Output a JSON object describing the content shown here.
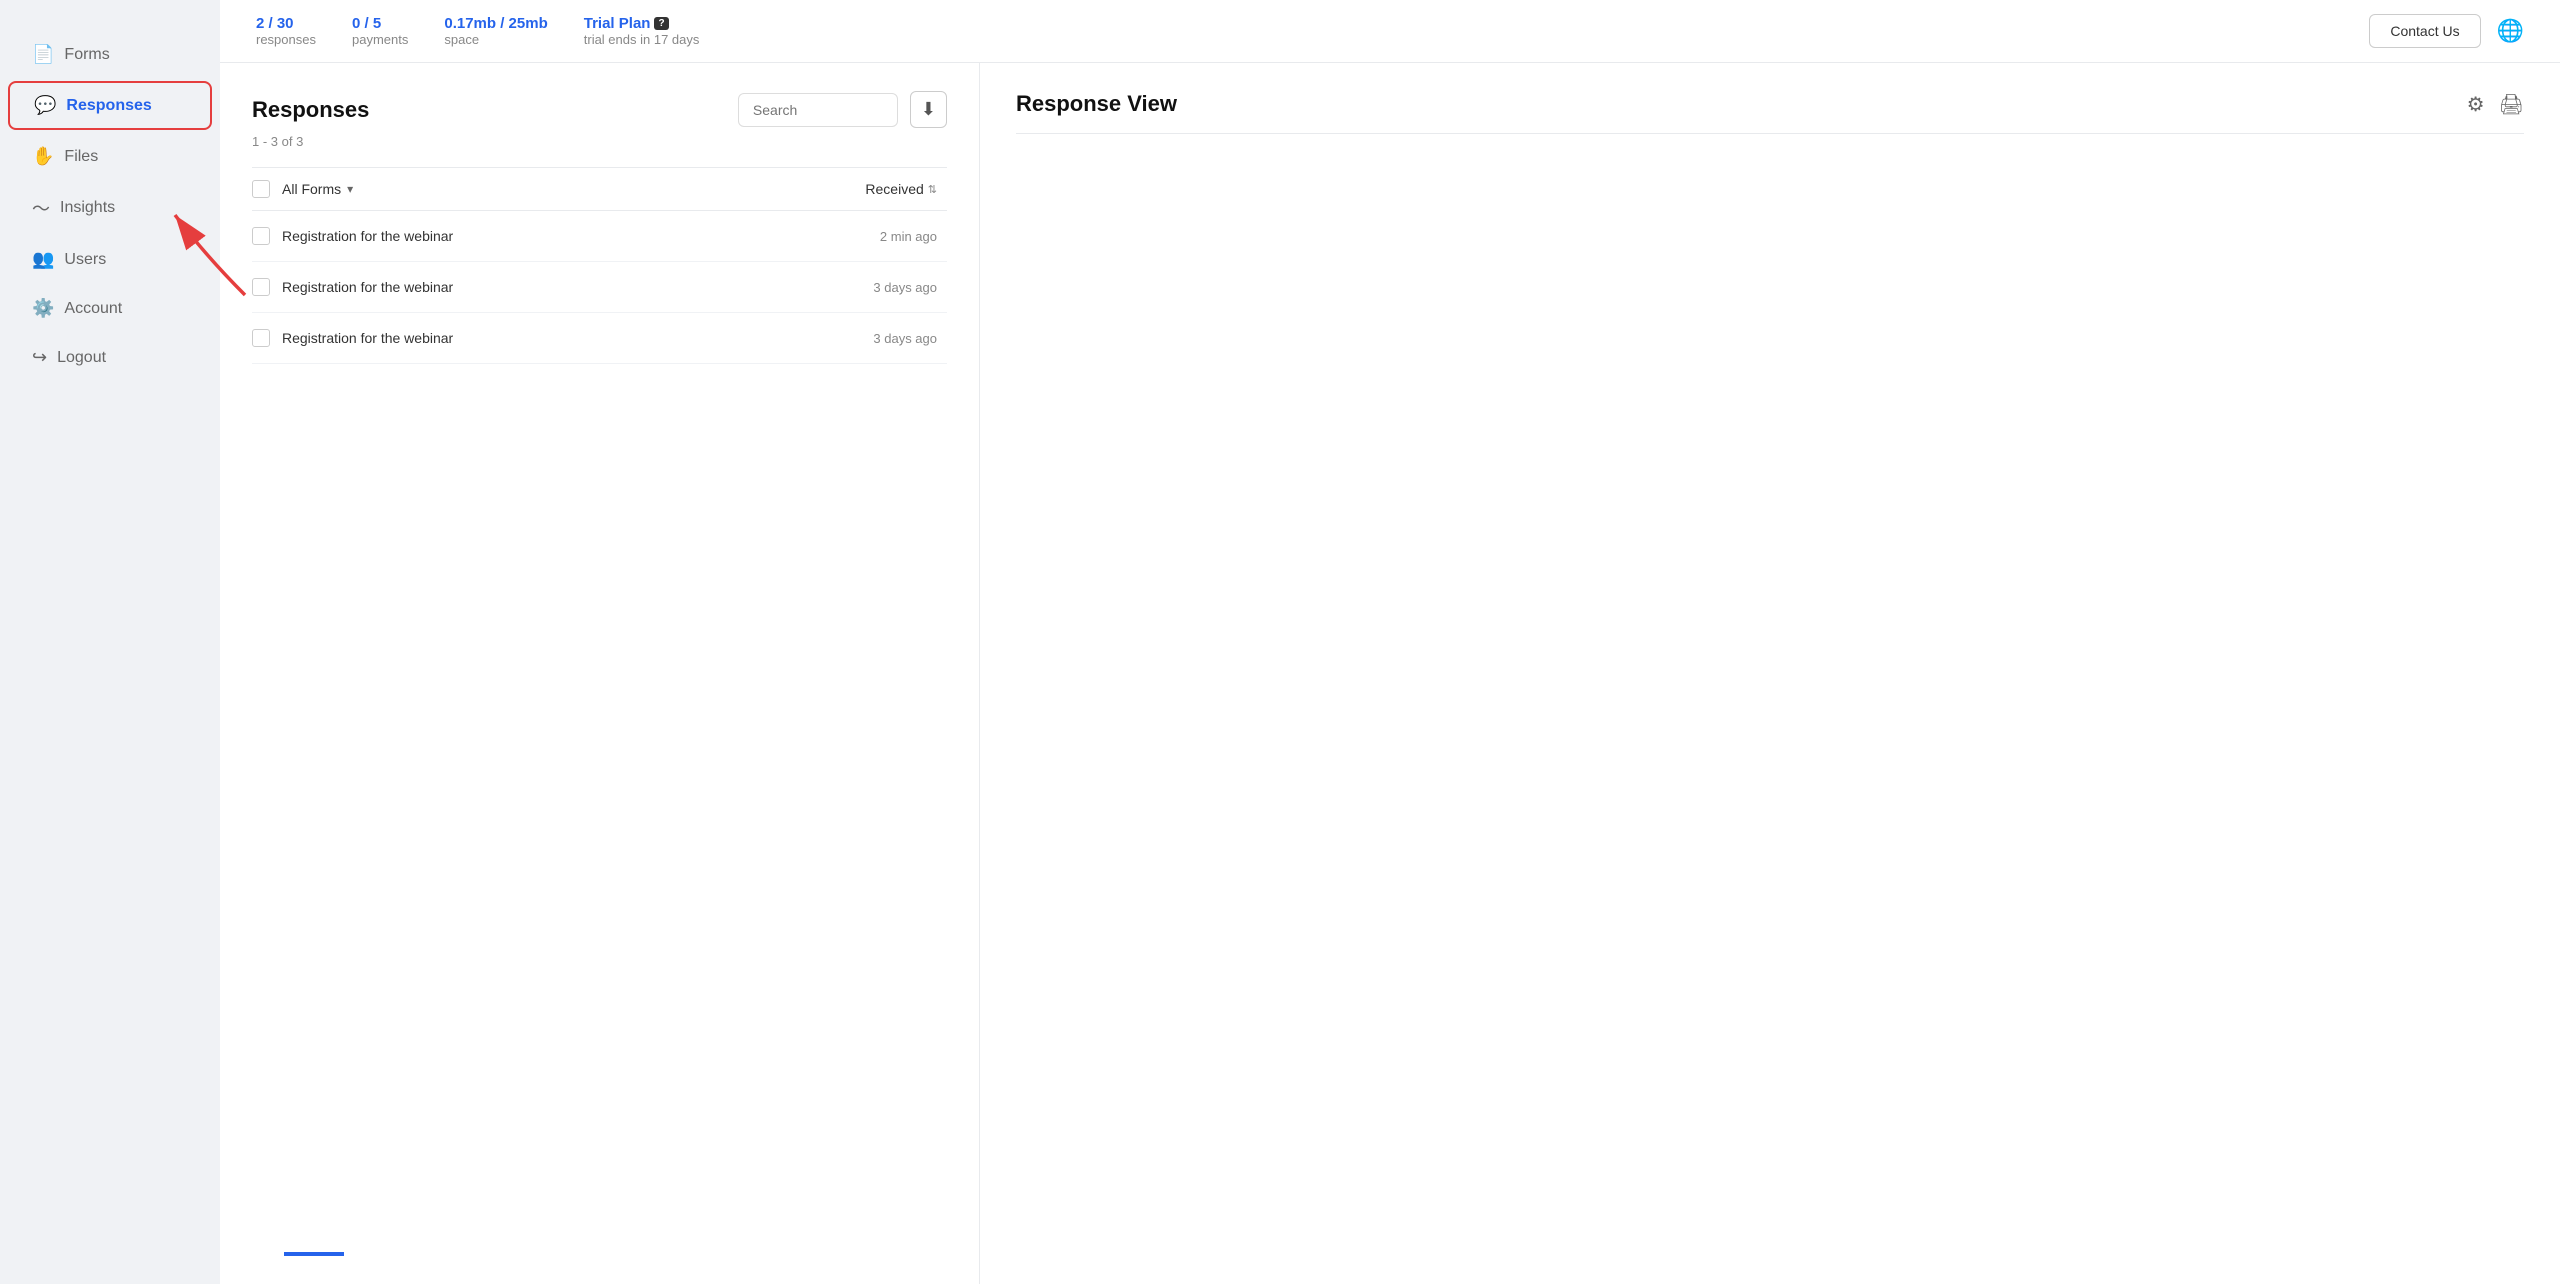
{
  "sidebar": {
    "items": [
      {
        "id": "forms",
        "label": "Forms",
        "icon": "📄",
        "active": false
      },
      {
        "id": "responses",
        "label": "Responses",
        "icon": "💬",
        "active": true
      },
      {
        "id": "files",
        "label": "Files",
        "icon": "✋",
        "active": false
      },
      {
        "id": "insights",
        "label": "Insights",
        "icon": "📈",
        "active": false
      },
      {
        "id": "users",
        "label": "Users",
        "icon": "👥",
        "active": false
      },
      {
        "id": "account",
        "label": "Account",
        "icon": "⚙️",
        "active": false
      },
      {
        "id": "logout",
        "label": "Logout",
        "icon": "🚪",
        "active": false
      }
    ]
  },
  "topbar": {
    "stats": [
      {
        "value": "2 / 30",
        "label": "responses"
      },
      {
        "value": "0 / 5",
        "label": "payments"
      },
      {
        "value": "0.17mb / 25mb",
        "label": "space"
      }
    ],
    "trial": {
      "plan_label": "Trial Plan",
      "ends_label": "trial ends in 17 days"
    },
    "contact_us": "Contact Us"
  },
  "responses_panel": {
    "title": "Responses",
    "count_label": "1 - 3 of 3",
    "search_placeholder": "Search",
    "table_header": {
      "all_forms": "All Forms",
      "received": "Received"
    },
    "rows": [
      {
        "name": "Registration for the webinar",
        "time": "2 min ago"
      },
      {
        "name": "Registration for the webinar",
        "time": "3 days ago"
      },
      {
        "name": "Registration for the webinar",
        "time": "3 days ago"
      }
    ]
  },
  "response_view": {
    "title": "Response View"
  }
}
